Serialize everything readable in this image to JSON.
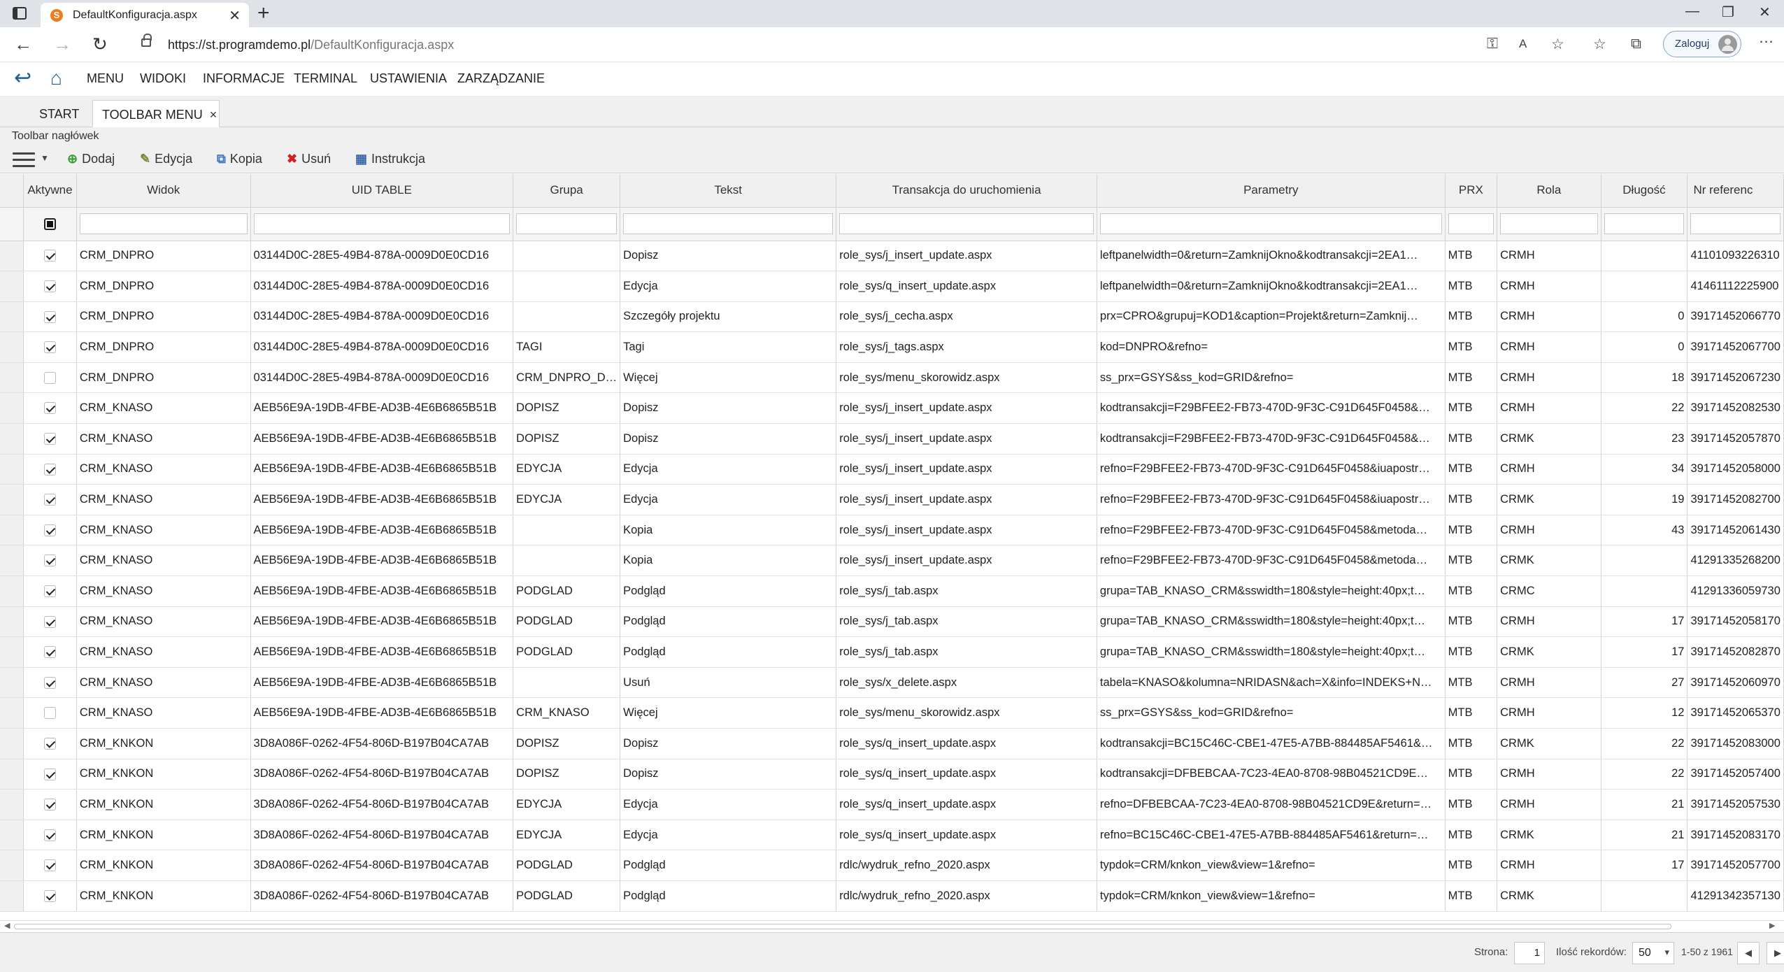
{
  "browser": {
    "tab_title": "DefaultKonfiguracja.aspx",
    "favicon_letter": "S",
    "url_domain": "https://st.programdemo.pl",
    "url_path": "/DefaultKonfiguracja.aspx",
    "login_label": "Zaloguj"
  },
  "menu": {
    "items": [
      "MENU",
      "WIDOKI",
      "INFORMACJE",
      "TERMINAL",
      "USTAWIENIA",
      "ZARZĄDZANIE"
    ]
  },
  "page_tabs": [
    {
      "label": "START"
    },
    {
      "label": "TOOLBAR MENU",
      "close": "×"
    }
  ],
  "section_title": "Toolbar nagłówek",
  "toolbar": {
    "add": "Dodaj",
    "edit": "Edycja",
    "copy": "Kopia",
    "delete": "Usuń",
    "instructions": "Instrukcja"
  },
  "grid": {
    "columns": [
      "Aktywne",
      "Widok",
      "UID TABLE",
      "Grupa",
      "Tekst",
      "Transakcja do uruchomienia",
      "Parametry",
      "PRX",
      "Rola",
      "Długość",
      "Nr referenc"
    ],
    "rows": [
      {
        "active": true,
        "widok": "CRM_DNPRO",
        "uid": "03144D0C-28E5-49B4-878A-0009D0E0CD16",
        "grupa": "",
        "tekst": "Dopisz",
        "trans": "role_sys/j_insert_update.aspx",
        "param": "leftpanelwidth=0&return=ZamknijOkno&kodtransakcji=2EA1…",
        "prx": "MTB",
        "rola": "CRMH",
        "dl": "",
        "nr": "41101093226310"
      },
      {
        "active": true,
        "widok": "CRM_DNPRO",
        "uid": "03144D0C-28E5-49B4-878A-0009D0E0CD16",
        "grupa": "",
        "tekst": "Edycja",
        "trans": "role_sys/q_insert_update.aspx",
        "param": "leftpanelwidth=0&return=ZamknijOkno&kodtransakcji=2EA1…",
        "prx": "MTB",
        "rola": "CRMH",
        "dl": "",
        "nr": "41461112225900"
      },
      {
        "active": true,
        "widok": "CRM_DNPRO",
        "uid": "03144D0C-28E5-49B4-878A-0009D0E0CD16",
        "grupa": "",
        "tekst": "Szczegóły projektu",
        "trans": "role_sys/j_cecha.aspx",
        "param": "prx=CPRO&grupuj=KOD1&caption=Projekt&return=Zamknij…",
        "prx": "MTB",
        "rola": "CRMH",
        "dl": "0",
        "nr": "39171452066770"
      },
      {
        "active": true,
        "widok": "CRM_DNPRO",
        "uid": "03144D0C-28E5-49B4-878A-0009D0E0CD16",
        "grupa": "TAGI",
        "tekst": "Tagi",
        "trans": "role_sys/j_tags.aspx",
        "param": "kod=DNPRO&refno=",
        "prx": "MTB",
        "rola": "CRMH",
        "dl": "0",
        "nr": "39171452067700"
      },
      {
        "active": false,
        "widok": "CRM_DNPRO",
        "uid": "03144D0C-28E5-49B4-878A-0009D0E0CD16",
        "grupa": "CRM_DNPRO_D…",
        "tekst": "Więcej",
        "trans": "role_sys/menu_skorowidz.aspx",
        "param": "ss_prx=GSYS&ss_kod=GRID&refno=",
        "prx": "MTB",
        "rola": "CRMH",
        "dl": "18",
        "nr": "39171452067230"
      },
      {
        "active": true,
        "widok": "CRM_KNASO",
        "uid": "AEB56E9A-19DB-4FBE-AD3B-4E6B6865B51B",
        "grupa": "DOPISZ",
        "tekst": "Dopisz",
        "trans": "role_sys/j_insert_update.aspx",
        "param": "kodtransakcji=F29BFEE2-FB73-470D-9F3C-C91D645F0458&…",
        "prx": "MTB",
        "rola": "CRMH",
        "dl": "22",
        "nr": "39171452082530"
      },
      {
        "active": true,
        "widok": "CRM_KNASO",
        "uid": "AEB56E9A-19DB-4FBE-AD3B-4E6B6865B51B",
        "grupa": "DOPISZ",
        "tekst": "Dopisz",
        "trans": "role_sys/j_insert_update.aspx",
        "param": "kodtransakcji=F29BFEE2-FB73-470D-9F3C-C91D645F0458&…",
        "prx": "MTB",
        "rola": "CRMK",
        "dl": "23",
        "nr": "39171452057870"
      },
      {
        "active": true,
        "widok": "CRM_KNASO",
        "uid": "AEB56E9A-19DB-4FBE-AD3B-4E6B6865B51B",
        "grupa": "EDYCJA",
        "tekst": "Edycja",
        "trans": "role_sys/j_insert_update.aspx",
        "param": "refno=F29BFEE2-FB73-470D-9F3C-C91D645F0458&iuapostr…",
        "prx": "MTB",
        "rola": "CRMH",
        "dl": "34",
        "nr": "39171452058000"
      },
      {
        "active": true,
        "widok": "CRM_KNASO",
        "uid": "AEB56E9A-19DB-4FBE-AD3B-4E6B6865B51B",
        "grupa": "EDYCJA",
        "tekst": "Edycja",
        "trans": "role_sys/j_insert_update.aspx",
        "param": "refno=F29BFEE2-FB73-470D-9F3C-C91D645F0458&iuapostr…",
        "prx": "MTB",
        "rola": "CRMK",
        "dl": "19",
        "nr": "39171452082700"
      },
      {
        "active": true,
        "widok": "CRM_KNASO",
        "uid": "AEB56E9A-19DB-4FBE-AD3B-4E6B6865B51B",
        "grupa": "",
        "tekst": "Kopia",
        "trans": "role_sys/j_insert_update.aspx",
        "param": "refno=F29BFEE2-FB73-470D-9F3C-C91D645F0458&metoda…",
        "prx": "MTB",
        "rola": "CRMH",
        "dl": "43",
        "nr": "39171452061430"
      },
      {
        "active": true,
        "widok": "CRM_KNASO",
        "uid": "AEB56E9A-19DB-4FBE-AD3B-4E6B6865B51B",
        "grupa": "",
        "tekst": "Kopia",
        "trans": "role_sys/j_insert_update.aspx",
        "param": "refno=F29BFEE2-FB73-470D-9F3C-C91D645F0458&metoda…",
        "prx": "MTB",
        "rola": "CRMK",
        "dl": "",
        "nr": "41291335268200"
      },
      {
        "active": true,
        "widok": "CRM_KNASO",
        "uid": "AEB56E9A-19DB-4FBE-AD3B-4E6B6865B51B",
        "grupa": "PODGLAD",
        "tekst": "Podgląd",
        "trans": "role_sys/j_tab.aspx",
        "param": "grupa=TAB_KNASO_CRM&sswidth=180&style=height:40px;t…",
        "prx": "MTB",
        "rola": "CRMC",
        "dl": "",
        "nr": "41291336059730"
      },
      {
        "active": true,
        "widok": "CRM_KNASO",
        "uid": "AEB56E9A-19DB-4FBE-AD3B-4E6B6865B51B",
        "grupa": "PODGLAD",
        "tekst": "Podgląd",
        "trans": "role_sys/j_tab.aspx",
        "param": "grupa=TAB_KNASO_CRM&sswidth=180&style=height:40px;t…",
        "prx": "MTB",
        "rola": "CRMH",
        "dl": "17",
        "nr": "39171452058170"
      },
      {
        "active": true,
        "widok": "CRM_KNASO",
        "uid": "AEB56E9A-19DB-4FBE-AD3B-4E6B6865B51B",
        "grupa": "PODGLAD",
        "tekst": "Podgląd",
        "trans": "role_sys/j_tab.aspx",
        "param": "grupa=TAB_KNASO_CRM&sswidth=180&style=height:40px;t…",
        "prx": "MTB",
        "rola": "CRMK",
        "dl": "17",
        "nr": "39171452082870"
      },
      {
        "active": true,
        "widok": "CRM_KNASO",
        "uid": "AEB56E9A-19DB-4FBE-AD3B-4E6B6865B51B",
        "grupa": "",
        "tekst": "Usuń",
        "trans": "role_sys/x_delete.aspx",
        "param": "tabela=KNASO&kolumna=NRIDASN&ach=X&info=INDEKS+N…",
        "prx": "MTB",
        "rola": "CRMH",
        "dl": "27",
        "nr": "39171452060970"
      },
      {
        "active": false,
        "widok": "CRM_KNASO",
        "uid": "AEB56E9A-19DB-4FBE-AD3B-4E6B6865B51B",
        "grupa": "CRM_KNASO",
        "tekst": "Więcej",
        "trans": "role_sys/menu_skorowidz.aspx",
        "param": "ss_prx=GSYS&ss_kod=GRID&refno=",
        "prx": "MTB",
        "rola": "CRMH",
        "dl": "12",
        "nr": "39171452065370"
      },
      {
        "active": true,
        "widok": "CRM_KNKON",
        "uid": "3D8A086F-0262-4F54-806D-B197B04CA7AB",
        "grupa": "DOPISZ",
        "tekst": "Dopisz",
        "trans": "role_sys/q_insert_update.aspx",
        "param": "kodtransakcji=BC15C46C-CBE1-47E5-A7BB-884485AF5461&…",
        "prx": "MTB",
        "rola": "CRMK",
        "dl": "22",
        "nr": "39171452083000"
      },
      {
        "active": true,
        "widok": "CRM_KNKON",
        "uid": "3D8A086F-0262-4F54-806D-B197B04CA7AB",
        "grupa": "DOPISZ",
        "tekst": "Dopisz",
        "trans": "role_sys/q_insert_update.aspx",
        "param": "kodtransakcji=DFBEBCAA-7C23-4EA0-8708-98B04521CD9E…",
        "prx": "MTB",
        "rola": "CRMH",
        "dl": "22",
        "nr": "39171452057400"
      },
      {
        "active": true,
        "widok": "CRM_KNKON",
        "uid": "3D8A086F-0262-4F54-806D-B197B04CA7AB",
        "grupa": "EDYCJA",
        "tekst": "Edycja",
        "trans": "role_sys/q_insert_update.aspx",
        "param": "refno=DFBEBCAA-7C23-4EA0-8708-98B04521CD9E&return=…",
        "prx": "MTB",
        "rola": "CRMH",
        "dl": "21",
        "nr": "39171452057530"
      },
      {
        "active": true,
        "widok": "CRM_KNKON",
        "uid": "3D8A086F-0262-4F54-806D-B197B04CA7AB",
        "grupa": "EDYCJA",
        "tekst": "Edycja",
        "trans": "role_sys/q_insert_update.aspx",
        "param": "refno=BC15C46C-CBE1-47E5-A7BB-884485AF5461&return=…",
        "prx": "MTB",
        "rola": "CRMK",
        "dl": "21",
        "nr": "39171452083170"
      },
      {
        "active": true,
        "widok": "CRM_KNKON",
        "uid": "3D8A086F-0262-4F54-806D-B197B04CA7AB",
        "grupa": "PODGLAD",
        "tekst": "Podgląd",
        "trans": "rdlc/wydruk_refno_2020.aspx",
        "param": "typdok=CRM/knkon_view&view=1&refno=",
        "prx": "MTB",
        "rola": "CRMH",
        "dl": "17",
        "nr": "39171452057700"
      },
      {
        "active": true,
        "widok": "CRM_KNKON",
        "uid": "3D8A086F-0262-4F54-806D-B197B04CA7AB",
        "grupa": "PODGLAD",
        "tekst": "Podgląd",
        "trans": "rdlc/wydruk_refno_2020.aspx",
        "param": "typdok=CRM/knkon_view&view=1&refno=",
        "prx": "MTB",
        "rola": "CRMK",
        "dl": "",
        "nr": "41291342357130"
      }
    ]
  },
  "footer": {
    "page_label": "Strona:",
    "page_value": "1",
    "records_label": "Ilość rekordów:",
    "page_size": "50",
    "range": "1-50 z 1961"
  }
}
